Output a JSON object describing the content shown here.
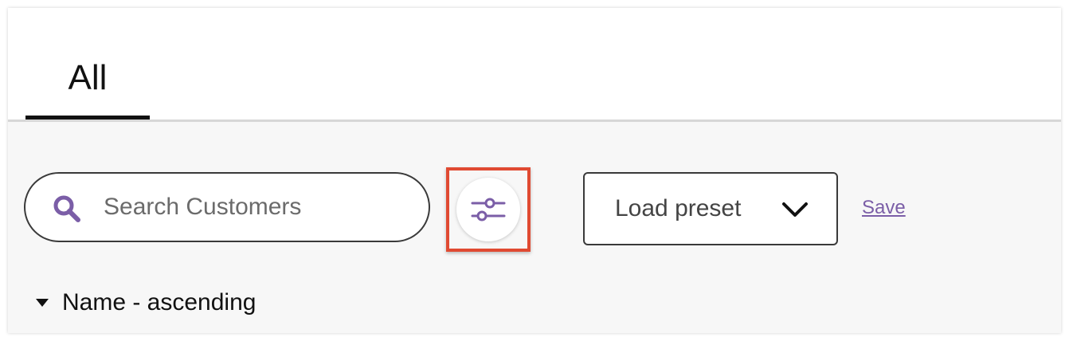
{
  "tabs": [
    {
      "label": "All",
      "active": true
    }
  ],
  "search": {
    "placeholder": "Search Customers",
    "value": ""
  },
  "filter": {
    "icon": "sliders-icon",
    "highlighted": true,
    "highlight_color": "#e04a32"
  },
  "preset": {
    "label": "Load preset",
    "icon": "chevron-down-icon"
  },
  "save": {
    "label": "Save"
  },
  "sort": {
    "label": "Name - ascending",
    "icon": "caret-down-icon"
  },
  "colors": {
    "accent": "#7b5ea7",
    "text": "#111111",
    "content_bg": "#f7f7f7"
  }
}
